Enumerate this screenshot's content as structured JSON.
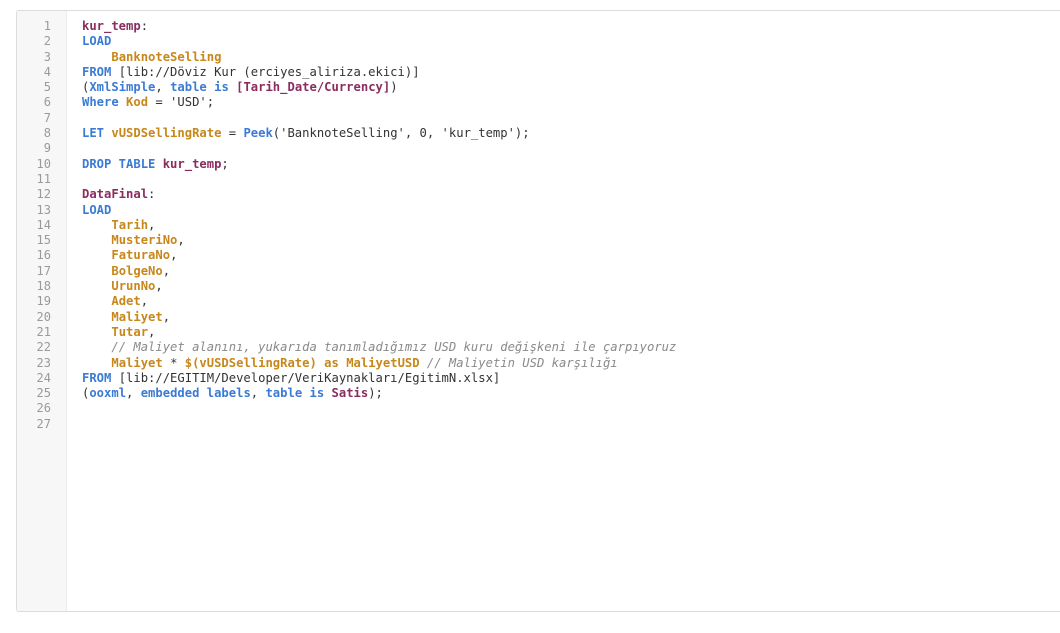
{
  "editor": {
    "lines": [
      {
        "n": "1",
        "segs": [
          {
            "t": "kur_temp",
            "c": "id"
          },
          {
            "t": ":",
            "c": "pun"
          }
        ]
      },
      {
        "n": "2",
        "segs": [
          {
            "t": "LOAD",
            "c": "kw"
          }
        ]
      },
      {
        "n": "3",
        "segs": [
          {
            "t": "    ",
            "c": "tx"
          },
          {
            "t": "BanknoteSelling",
            "c": "fld"
          }
        ]
      },
      {
        "n": "4",
        "segs": [
          {
            "t": "FROM",
            "c": "kw"
          },
          {
            "t": " [lib://Döviz Kur (erciyes_aliriza.ekici)]",
            "c": "tx"
          }
        ]
      },
      {
        "n": "5",
        "segs": [
          {
            "t": "(",
            "c": "pun"
          },
          {
            "t": "XmlSimple",
            "c": "kw"
          },
          {
            "t": ", ",
            "c": "pun"
          },
          {
            "t": "table is",
            "c": "kw"
          },
          {
            "t": " ",
            "c": "tx"
          },
          {
            "t": "[Tarih_Date/Currency]",
            "c": "id"
          },
          {
            "t": ")",
            "c": "pun"
          }
        ]
      },
      {
        "n": "6",
        "segs": [
          {
            "t": "Where",
            "c": "kw"
          },
          {
            "t": " ",
            "c": "tx"
          },
          {
            "t": "Kod",
            "c": "fld"
          },
          {
            "t": " = 'USD';",
            "c": "tx"
          }
        ]
      },
      {
        "n": "7",
        "segs": []
      },
      {
        "n": "8",
        "segs": [
          {
            "t": "LET",
            "c": "kw"
          },
          {
            "t": " ",
            "c": "tx"
          },
          {
            "t": "vUSDSellingRate",
            "c": "var"
          },
          {
            "t": " = ",
            "c": "tx"
          },
          {
            "t": "Peek",
            "c": "fn"
          },
          {
            "t": "('BanknoteSelling', 0, 'kur_temp');",
            "c": "tx"
          }
        ]
      },
      {
        "n": "9",
        "segs": []
      },
      {
        "n": "10",
        "segs": [
          {
            "t": "DROP TABLE",
            "c": "kw"
          },
          {
            "t": " ",
            "c": "tx"
          },
          {
            "t": "kur_temp",
            "c": "id"
          },
          {
            "t": ";",
            "c": "pun"
          }
        ]
      },
      {
        "n": "11",
        "segs": []
      },
      {
        "n": "12",
        "segs": [
          {
            "t": "DataFinal",
            "c": "id"
          },
          {
            "t": ":",
            "c": "pun"
          }
        ]
      },
      {
        "n": "13",
        "segs": [
          {
            "t": "LOAD",
            "c": "kw"
          }
        ]
      },
      {
        "n": "14",
        "segs": [
          {
            "t": "    ",
            "c": "tx"
          },
          {
            "t": "Tarih",
            "c": "fld"
          },
          {
            "t": ",",
            "c": "pun"
          }
        ]
      },
      {
        "n": "15",
        "segs": [
          {
            "t": "    ",
            "c": "tx"
          },
          {
            "t": "MusteriNo",
            "c": "fld"
          },
          {
            "t": ",",
            "c": "pun"
          }
        ]
      },
      {
        "n": "16",
        "segs": [
          {
            "t": "    ",
            "c": "tx"
          },
          {
            "t": "FaturaNo",
            "c": "fld"
          },
          {
            "t": ",",
            "c": "pun"
          }
        ]
      },
      {
        "n": "17",
        "segs": [
          {
            "t": "    ",
            "c": "tx"
          },
          {
            "t": "BolgeNo",
            "c": "fld"
          },
          {
            "t": ",",
            "c": "pun"
          }
        ]
      },
      {
        "n": "18",
        "segs": [
          {
            "t": "    ",
            "c": "tx"
          },
          {
            "t": "UrunNo",
            "c": "fld"
          },
          {
            "t": ",",
            "c": "pun"
          }
        ]
      },
      {
        "n": "19",
        "segs": [
          {
            "t": "    ",
            "c": "tx"
          },
          {
            "t": "Adet",
            "c": "fld"
          },
          {
            "t": ",",
            "c": "pun"
          }
        ]
      },
      {
        "n": "20",
        "segs": [
          {
            "t": "    ",
            "c": "tx"
          },
          {
            "t": "Maliyet",
            "c": "fld"
          },
          {
            "t": ",",
            "c": "pun"
          }
        ]
      },
      {
        "n": "21",
        "segs": [
          {
            "t": "    ",
            "c": "tx"
          },
          {
            "t": "Tutar",
            "c": "fld"
          },
          {
            "t": ",",
            "c": "pun"
          }
        ]
      },
      {
        "n": "22",
        "segs": [
          {
            "t": "    ",
            "c": "tx"
          },
          {
            "t": "// Maliyet alanını, yukarıda tanımladığımız USD kuru değişkeni ile çarpıyoruz",
            "c": "cm"
          }
        ]
      },
      {
        "n": "23",
        "segs": [
          {
            "t": "    ",
            "c": "tx"
          },
          {
            "t": "Maliyet",
            "c": "fld"
          },
          {
            "t": " * ",
            "c": "tx"
          },
          {
            "t": "$(vUSDSellingRate)",
            "c": "var"
          },
          {
            "t": " ",
            "c": "tx"
          },
          {
            "t": "as",
            "c": "fld"
          },
          {
            "t": " ",
            "c": "tx"
          },
          {
            "t": "MaliyetUSD",
            "c": "fld"
          },
          {
            "t": " ",
            "c": "tx"
          },
          {
            "t": "// Maliyetin USD karşılığı",
            "c": "cm"
          }
        ]
      },
      {
        "n": "24",
        "segs": [
          {
            "t": "FROM",
            "c": "kw"
          },
          {
            "t": " [lib://EGITIM/Developer/VeriKaynakları/EgitimN.xlsx]",
            "c": "tx"
          }
        ]
      },
      {
        "n": "25",
        "segs": [
          {
            "t": "(",
            "c": "pun"
          },
          {
            "t": "ooxml",
            "c": "kw"
          },
          {
            "t": ", ",
            "c": "pun"
          },
          {
            "t": "embedded labels",
            "c": "kw"
          },
          {
            "t": ", ",
            "c": "pun"
          },
          {
            "t": "table is",
            "c": "kw"
          },
          {
            "t": " ",
            "c": "tx"
          },
          {
            "t": "Satis",
            "c": "id"
          },
          {
            "t": ");",
            "c": "pun"
          }
        ]
      },
      {
        "n": "26",
        "segs": []
      },
      {
        "n": "27",
        "segs": []
      }
    ]
  },
  "colors": {
    "keyword": "#3a7bd5",
    "identifier": "#8b2c5f",
    "field": "#c7871a",
    "comment": "#8a8a8a",
    "text": "#333333",
    "line_number": "#9a9a9a"
  }
}
